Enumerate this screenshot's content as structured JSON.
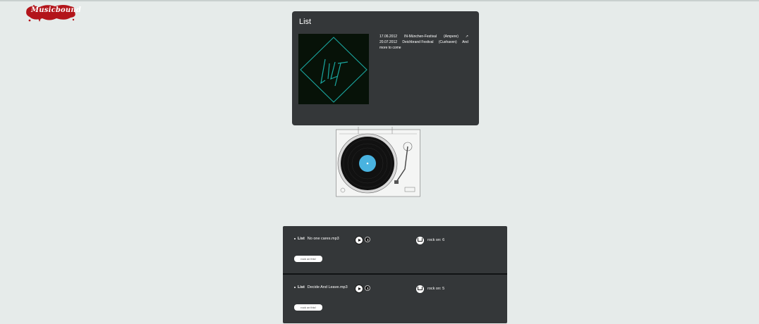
{
  "logo": {
    "text": "Musicbound",
    "icon": "paint-splash-logo"
  },
  "band": {
    "title": "List",
    "cover_icon": "list-band-logo",
    "events": [
      {
        "date": "17.06.2012",
        "name": "IN-München-Festival",
        "note": "(Ampere)",
        "arrow": "↗"
      },
      {
        "date": "20.07.2012",
        "name": "Deichbrand Festival",
        "note": "(Cuxhaven)",
        "arrow": "And"
      }
    ],
    "more_text": "more to come"
  },
  "turntable": {
    "icon": "record-player-icon"
  },
  "songs": [
    {
      "artist": "List",
      "title": "No one cares.mp3",
      "rock_text": "rock on: 6",
      "rock_button": "rock on this!"
    },
    {
      "artist": "List",
      "title": "Decide And Leave.mp3",
      "rock_text": "rock on: 5",
      "rock_button": "rock on this!"
    }
  ],
  "colors": {
    "background": "#e6ebea",
    "panel": "#343739",
    "logo_red": "#b3151b",
    "accent_blue": "#49b3e0",
    "cover_lines": "#1aa7a0"
  }
}
